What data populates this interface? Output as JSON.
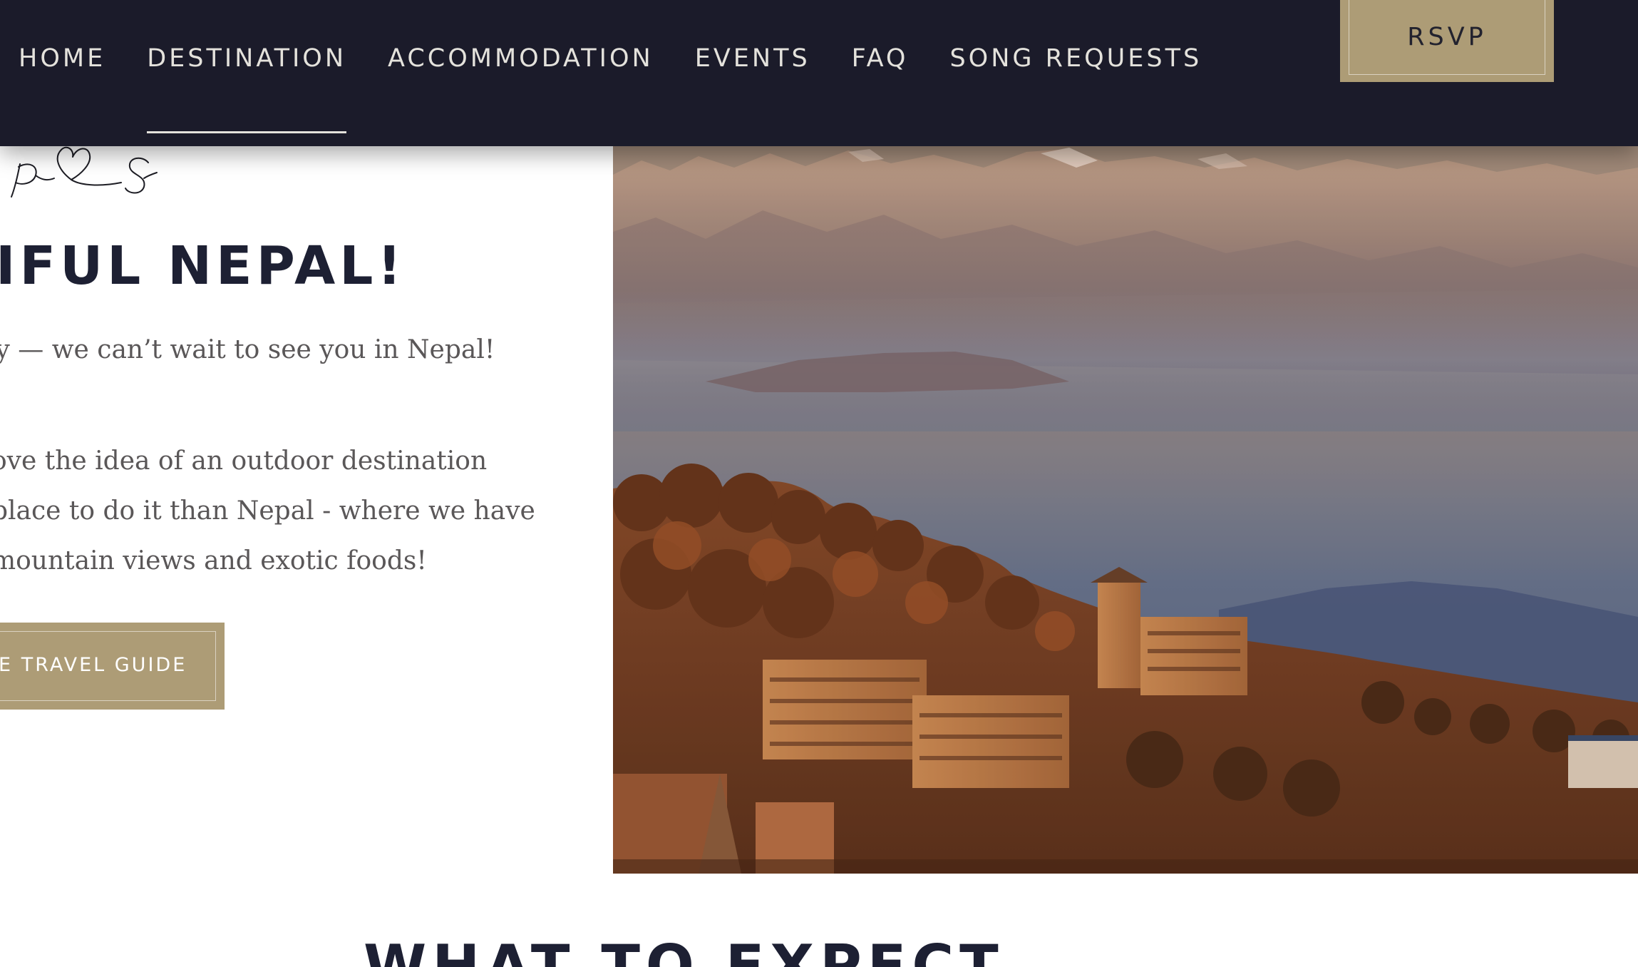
{
  "nav": {
    "items": [
      {
        "label": "HOME"
      },
      {
        "label": "DESTINATION",
        "active": true
      },
      {
        "label": "ACCOMMODATION"
      },
      {
        "label": "EVENTS"
      },
      {
        "label": "FAQ"
      },
      {
        "label": "SONG REQUESTS"
      }
    ],
    "rsvp_label": "RSVP"
  },
  "hero": {
    "heading": "IFUL NEPAL!",
    "intro": "ly — we can’t wait to see you in Nepal!",
    "paragraph_lines": [
      "ove the idea of an outdoor destination",
      "place to do it than Nepal - where we have",
      "mountain views and exotic foods!"
    ],
    "guide_button_label": "EE TRAVEL GUIDE"
  },
  "photo": {
    "subject": "mountain-village-sunrise"
  },
  "section": {
    "heading": "WHAT TO EXPECT"
  },
  "colors": {
    "nav_background": "#1b1b2a",
    "accent_gold": "#ad9c76",
    "heading_navy": "#1d2033",
    "body_text": "#5a5758"
  }
}
